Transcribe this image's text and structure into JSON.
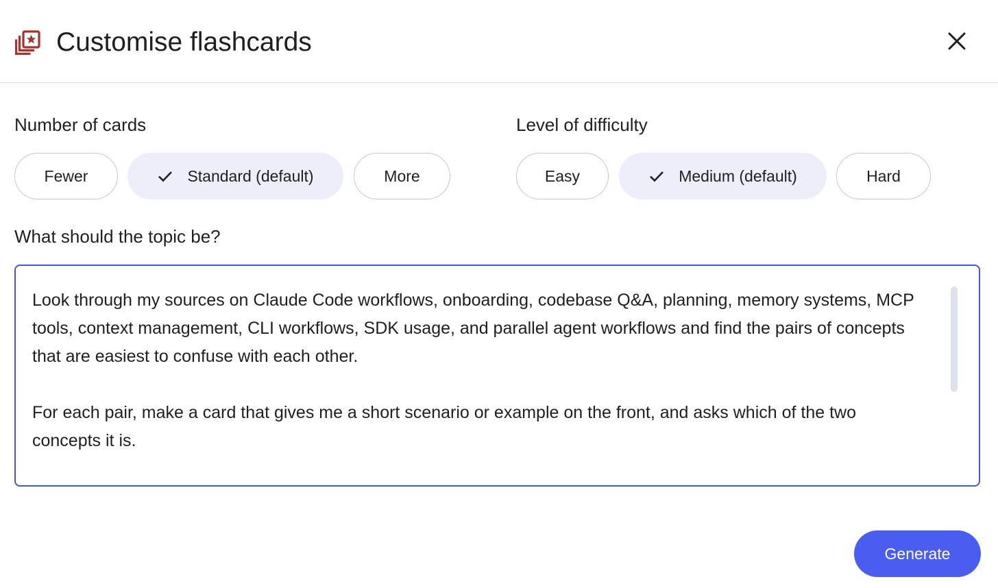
{
  "header": {
    "title": "Customise flashcards",
    "icon": "flashcards-icon",
    "close_icon": "close-icon"
  },
  "number_of_cards": {
    "label": "Number of cards",
    "options": [
      {
        "label": "Fewer",
        "selected": false
      },
      {
        "label": "Standard (default)",
        "selected": true
      },
      {
        "label": "More",
        "selected": false
      }
    ]
  },
  "difficulty": {
    "label": "Level of difficulty",
    "options": [
      {
        "label": "Easy",
        "selected": false
      },
      {
        "label": "Medium (default)",
        "selected": true
      },
      {
        "label": "Hard",
        "selected": false
      }
    ]
  },
  "topic": {
    "label": "What should the topic be?",
    "paragraphs": [
      "Look through my sources on Claude Code workflows, onboarding, codebase Q&A, planning, memory systems, MCP tools, context management, CLI workflows, SDK usage, and parallel agent workflows and find the pairs of concepts that are easiest to confuse with each other.",
      "For each pair, make a card that gives me a short scenario or example on the front, and asks which of the two concepts it is."
    ]
  },
  "actions": {
    "generate_label": "Generate"
  },
  "colors": {
    "accent": "#4a5df0",
    "focus_border": "#4455e0",
    "selected_chip": "#eceef9",
    "icon_red": "#a8322a"
  }
}
